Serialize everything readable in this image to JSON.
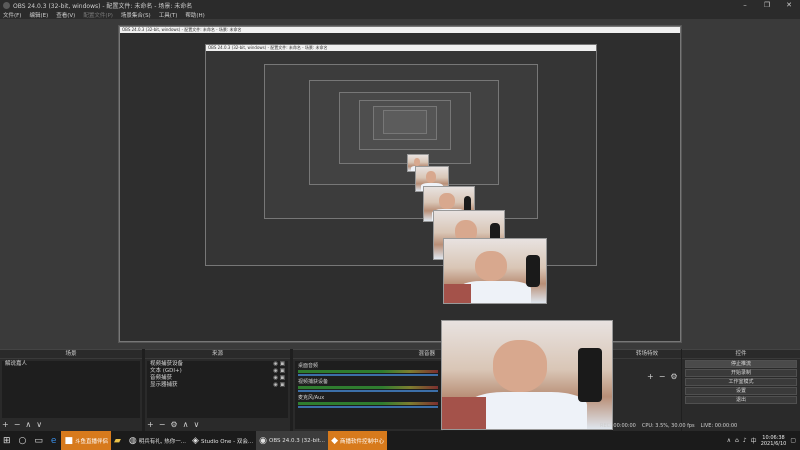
{
  "window": {
    "title": "OBS 24.0.3 (32-bit, windows) - 配置文件: 未命名 - 场景: 未命名",
    "controls": [
      "–",
      "❐",
      "✕"
    ]
  },
  "menu": {
    "items": [
      {
        "label": "文件(F)",
        "disabled": false
      },
      {
        "label": "编辑(E)",
        "disabled": false
      },
      {
        "label": "查看(V)",
        "disabled": false
      },
      {
        "label": "配置文件(P)",
        "disabled": true
      },
      {
        "label": "场景集合(S)",
        "disabled": false
      },
      {
        "label": "工具(T)",
        "disabled": false
      },
      {
        "label": "帮助(H)",
        "disabled": false
      }
    ]
  },
  "preview": {
    "nested_title": "OBS 24.0.3 (32-bit, windows) - 配置文件: 未命名 - 场景: 未命名"
  },
  "docks": {
    "scenes": {
      "header": "场景",
      "items": [
        "解说嘉人"
      ],
      "footer": [
        "+",
        "−",
        "∧",
        "∨"
      ]
    },
    "sources": {
      "header": "来源",
      "items": [
        "视频捕获设备",
        "文本 (GDI+)",
        "音频捕获",
        "显示器捕获"
      ],
      "footer": [
        "+",
        "−",
        "⚙",
        "∧",
        "∨"
      ]
    },
    "mixer": {
      "header": "混音器",
      "channels": [
        {
          "label": "桌面音频"
        },
        {
          "label": "视频捕获设备"
        },
        {
          "label": "麦克风/Aux"
        }
      ]
    },
    "transitions": {
      "header": "转场特效",
      "footer": [
        "+",
        "−",
        "⚙"
      ]
    },
    "controls": {
      "header": "控件",
      "buttons": [
        "停止推流",
        "开始录制",
        "工作室模式",
        "设置",
        "退出"
      ]
    }
  },
  "status": {
    "rec": "REC: 00:00:00",
    "cpu": "CPU: 3.5%, 30.00 fps",
    "live": "LIVE: 00:00:00"
  },
  "taskbar": {
    "items": [
      {
        "label": "斗鱼直播伴侣",
        "style": "orange"
      },
      {
        "label": "明兵有礼, 热你一...",
        "style": "normal"
      },
      {
        "label": "Studio One - 双会...",
        "style": "normal"
      },
      {
        "label": "OBS 24.0.3 (32-bit...",
        "style": "active"
      },
      {
        "label": "商播软件控制中心",
        "style": "orange"
      }
    ],
    "clock_time": "10:06:38",
    "clock_date": "2021/6/10"
  },
  "colors": {
    "accent_orange": "#d77a1c",
    "panel_bg": "#2a2a2a",
    "preview_bg": "#3a3a3a"
  }
}
